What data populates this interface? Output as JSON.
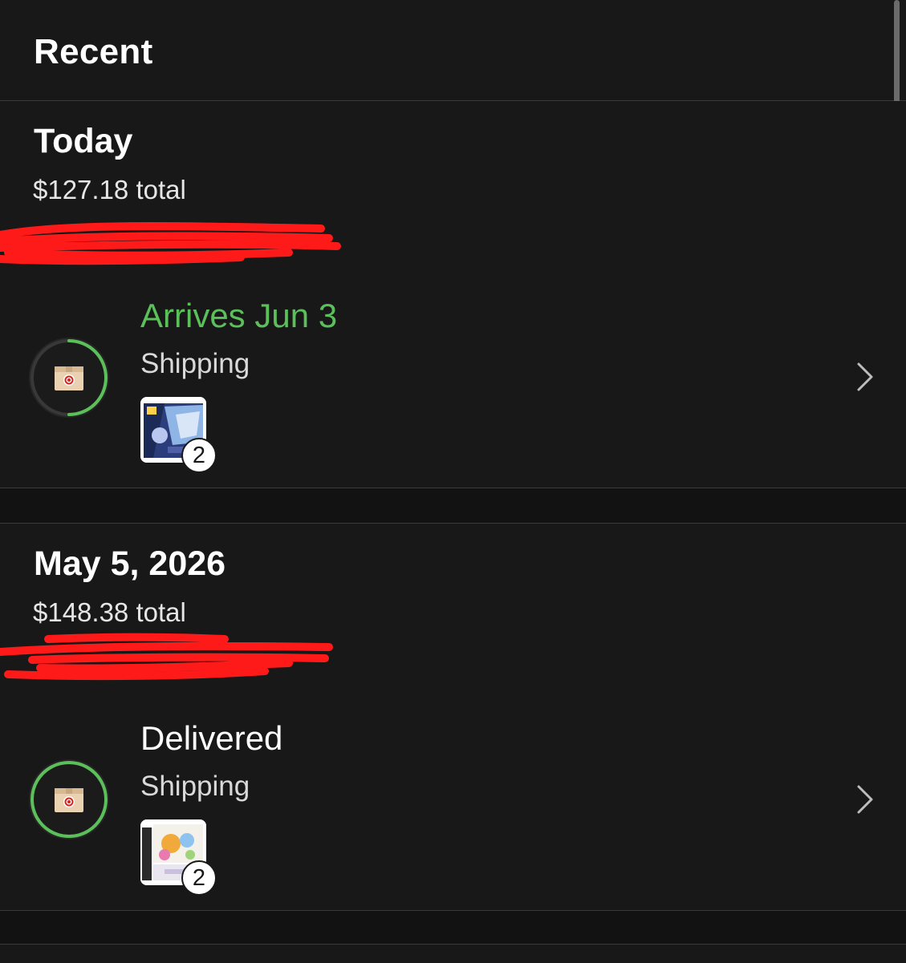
{
  "header": {
    "title": "Recent"
  },
  "orders": [
    {
      "date_label": "Today",
      "total": "$127.18 total",
      "status": "Arrives Jun 3",
      "status_color": "#5cc05a",
      "progress": 0.5,
      "method": "Shipping",
      "item_count": "2",
      "status_icon": "target-box-icon",
      "thumbnail": "product-box-blue-art"
    },
    {
      "date_label": "May 5, 2026",
      "total": "$148.38 total",
      "status": "Delivered",
      "status_color": "#ffffff",
      "progress": 1.0,
      "method": "Shipping",
      "item_count": "2",
      "status_icon": "target-box-icon",
      "thumbnail": "product-box-white-art"
    }
  ],
  "colors": {
    "background": "#121212",
    "card": "#181818",
    "accent_green": "#5cc05a",
    "redaction": "#ff1a1a"
  }
}
